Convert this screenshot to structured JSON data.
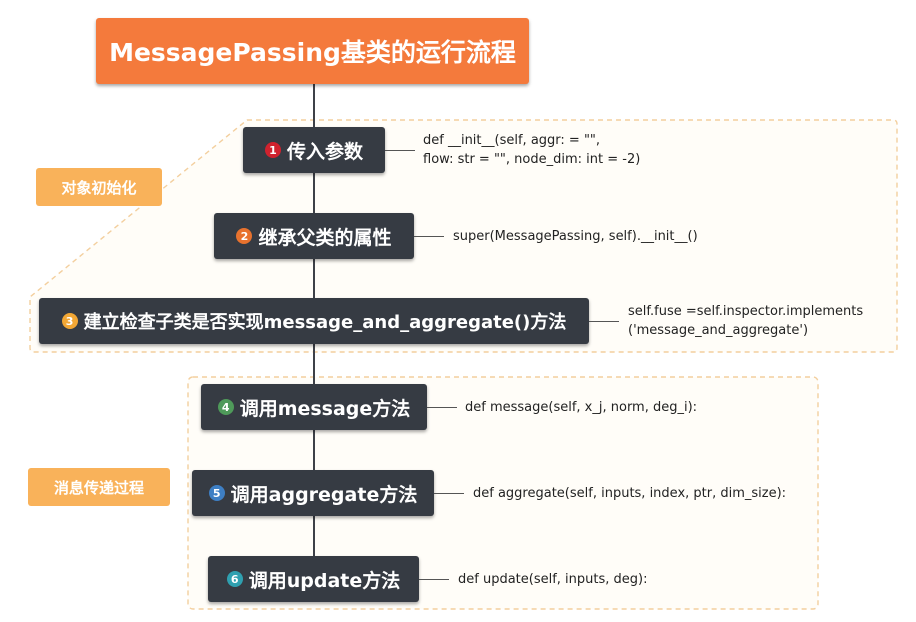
{
  "title": "MessagePassing基类的运行流程",
  "groups": {
    "init": "对象初始化",
    "message": "消息传递过程"
  },
  "steps": [
    {
      "num": "1",
      "label": "传入参数",
      "badge_color": "#d0222e",
      "code": [
        "def __init__(self, aggr: = \"\",",
        "flow: str = \"\", node_dim: int = -2)"
      ]
    },
    {
      "num": "2",
      "label": "继承父类的属性",
      "badge_color": "#e8722e",
      "code": [
        "super(MessagePassing, self).__init__()"
      ]
    },
    {
      "num": "3",
      "label": "建立检查子类是否实现message_and_aggregate()方法",
      "badge_color": "#f2a735",
      "code": [
        "self.fuse =self.inspector.implements",
        "('message_and_aggregate')"
      ]
    },
    {
      "num": "4",
      "label": "调用message方法",
      "badge_color": "#4f9a5a",
      "code": [
        "def message(self, x_j, norm, deg_i):"
      ]
    },
    {
      "num": "5",
      "label": "调用aggregate方法",
      "badge_color": "#3e7fc4",
      "code": [
        "def aggregate(self, inputs, index, ptr, dim_size):"
      ]
    },
    {
      "num": "6",
      "label": "调用update方法",
      "badge_color": "#2fa0b0",
      "code": [
        "def update(self, inputs, deg):"
      ]
    }
  ]
}
